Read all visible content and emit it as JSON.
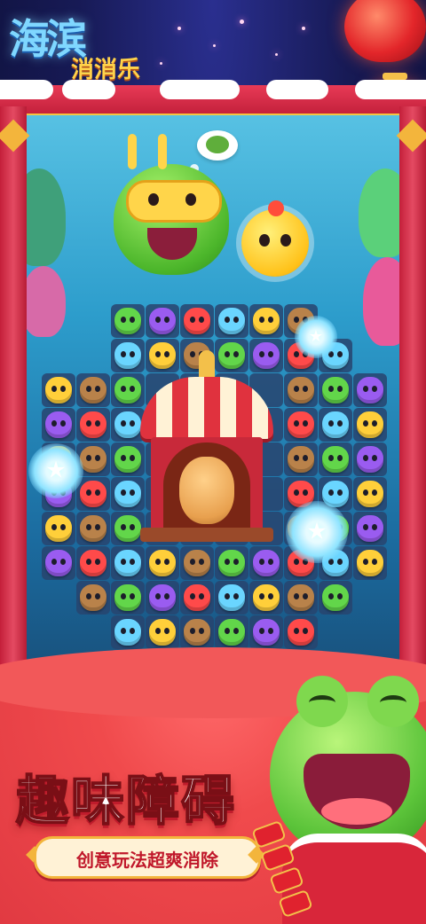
{
  "game": {
    "logo_line1": "海滨",
    "logo_line2": "消消乐",
    "headline": "趣味障碍",
    "subheadline": "创意玩法超爽消除"
  },
  "board": {
    "center_obstacle": "circus-tent",
    "special_items": [
      "star-orb",
      "star-orb",
      "star-orb"
    ]
  },
  "colors": {
    "frame_red": "#d7263f",
    "ocean_blue": "#2d9dcc",
    "banner_red": "#f04a4c",
    "gold": "#f3b53c"
  }
}
